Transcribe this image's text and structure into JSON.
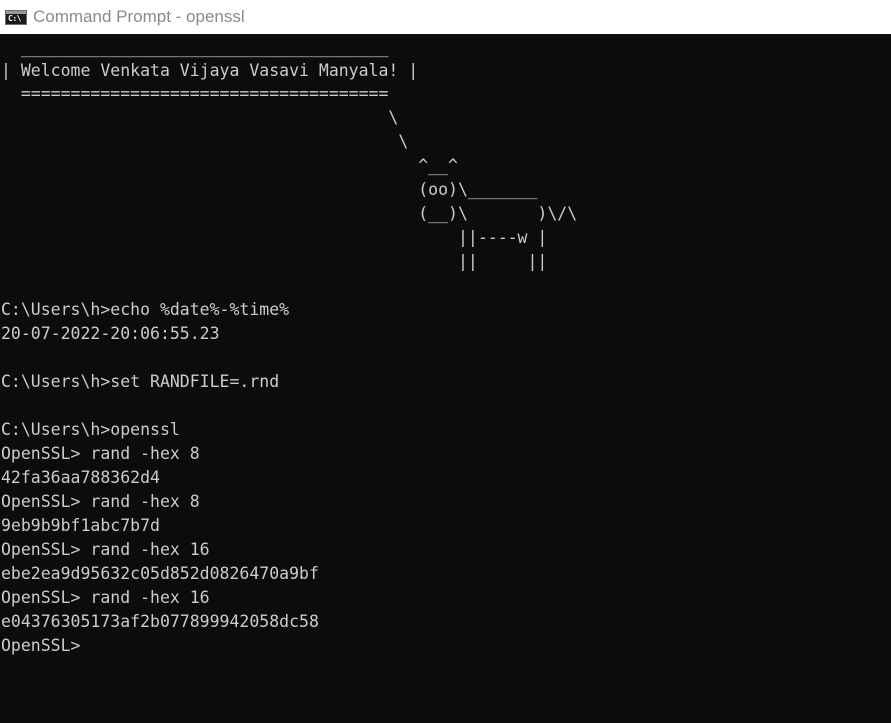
{
  "window": {
    "title": "Command Prompt - openssl",
    "icon_label": "C:\\"
  },
  "banner": {
    "top_border": "  _____________________________________",
    "greeting": "| Welcome Venkata Vijaya Vasavi Manyala! |",
    "bottom_border": "  =====================================",
    "cow": [
      "                                       \\",
      "                                        \\",
      "                                          ^__^",
      "                                          (oo)\\_______",
      "                                          (__)\\       )\\/\\",
      "                                              ||----w |",
      "                                              ||     ||"
    ]
  },
  "session": {
    "lines": [
      "C:\\Users\\h>echo %date%-%time%",
      "20-07-2022-20:06:55.23",
      "",
      "C:\\Users\\h>set RANDFILE=.rnd",
      "",
      "C:\\Users\\h>openssl",
      "OpenSSL> rand -hex 8",
      "42fa36aa788362d4",
      "OpenSSL> rand -hex 8",
      "9eb9b9bf1abc7b7d",
      "OpenSSL> rand -hex 16",
      "ebe2ea9d95632c05d852d0826470a9bf",
      "OpenSSL> rand -hex 16",
      "e04376305173af2b077899942058dc58",
      "OpenSSL>"
    ]
  }
}
